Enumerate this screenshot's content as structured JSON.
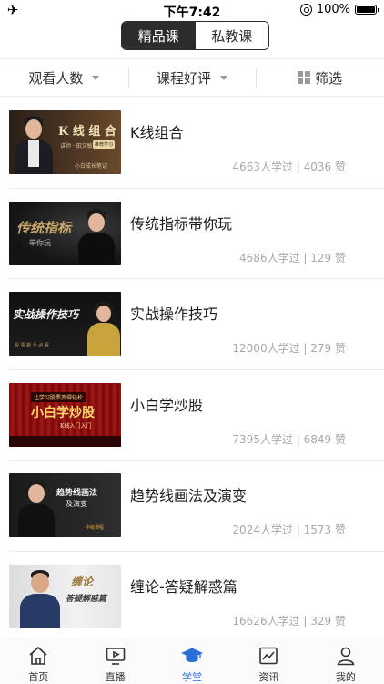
{
  "status_bar": {
    "time": "下午7:42",
    "battery": "100%",
    "icons": [
      "airplane-icon",
      "orientation-lock-icon",
      "battery-icon"
    ]
  },
  "header": {
    "segments": [
      {
        "label": "精品课",
        "active": true
      },
      {
        "label": "私教课",
        "active": false
      }
    ]
  },
  "filters": [
    {
      "label": "观看人数",
      "icon": "caret-down-icon"
    },
    {
      "label": "课程好评",
      "icon": "caret-down-icon"
    },
    {
      "label": "筛选",
      "icon": "grid-filter-icon"
    }
  ],
  "courses": [
    {
      "title": "K线组合",
      "learners": "4663人学过",
      "likes": "4036 赞",
      "thumb": {
        "headline": "K 线 组 合",
        "sub": "讲师 · 田文敏",
        "badge": "推荐学习",
        "footer": "小白成长笔记"
      }
    },
    {
      "title": "传统指标带你玩",
      "learners": "4686人学过",
      "likes": "129 赞",
      "thumb": {
        "headline": "传统指标",
        "sub": "带你玩"
      }
    },
    {
      "title": "实战操作技巧",
      "learners": "12000人学过",
      "likes": "279 赞",
      "thumb": {
        "headline": "实战操作技巧",
        "sub": "股 票 新 手 必 看"
      }
    },
    {
      "title": "小白学炒股",
      "learners": "7395人学过",
      "likes": "6849 赞",
      "thumb": {
        "headline": "小白学炒股",
        "sub": "让学习股票变得轻松",
        "footer": "K线入门入门"
      }
    },
    {
      "title": "趋势线画法及演变",
      "learners": "2024人学过",
      "likes": "1573 赞",
      "thumb": {
        "headline": "趋势线画法",
        "sub": "及演变",
        "footer": "中级课程"
      }
    },
    {
      "title": "缠论-答疑解惑篇",
      "learners": "16626人学过",
      "likes": "329 赞",
      "thumb": {
        "headline": "缠论",
        "sub": "答疑解惑篇"
      }
    }
  ],
  "tab_bar": [
    {
      "label": "首页",
      "icon": "home-icon",
      "active": false
    },
    {
      "label": "直播",
      "icon": "live-tv-icon",
      "active": false
    },
    {
      "label": "学堂",
      "icon": "graduation-cap-icon",
      "active": true
    },
    {
      "label": "资讯",
      "icon": "chart-news-icon",
      "active": false
    },
    {
      "label": "我的",
      "icon": "profile-icon",
      "active": false
    }
  ],
  "colors": {
    "accent": "#2d6fd8",
    "segment_dark": "#2c2c2c",
    "meta_text": "#a8a8a8"
  }
}
